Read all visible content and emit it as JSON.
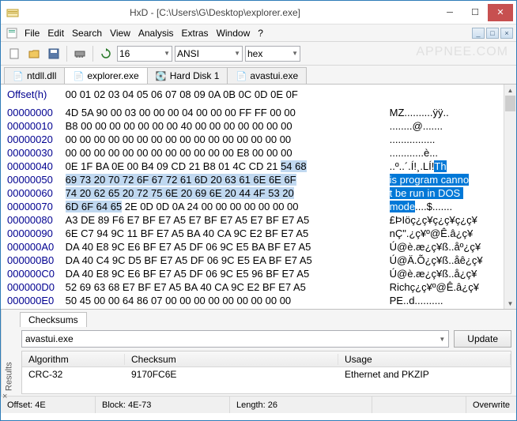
{
  "window": {
    "title": "HxD - [C:\\Users\\G\\Desktop\\explorer.exe]",
    "watermark": "APPNEE.COM"
  },
  "menus": [
    "File",
    "Edit",
    "Search",
    "View",
    "Analysis",
    "Extras",
    "Window",
    "?"
  ],
  "toolbar": {
    "bytes_per_row": "16",
    "charset": "ANSI",
    "base": "hex"
  },
  "tabs": [
    {
      "icon": "file-icon",
      "label": "ntdll.dll",
      "active": false
    },
    {
      "icon": "file-icon",
      "label": "explorer.exe",
      "active": true
    },
    {
      "icon": "disk-icon",
      "label": "Hard Disk 1",
      "active": false
    },
    {
      "icon": "file-icon",
      "label": "avastui.exe",
      "active": false
    }
  ],
  "hex": {
    "header_offset": "Offset(h)",
    "header_cols": "00 01 02 03 04 05 06 07 08 09 0A 0B 0C 0D 0E 0F",
    "rows": [
      {
        "off": "00000000",
        "b": "4D 5A 90 00 03 00 00 00 04 00 00 00 FF FF 00 00",
        "a": "MZ..........ÿÿ.."
      },
      {
        "off": "00000010",
        "b": "B8 00 00 00 00 00 00 00 40 00 00 00 00 00 00 00",
        "a": "........@......."
      },
      {
        "off": "00000020",
        "b": "00 00 00 00 00 00 00 00 00 00 00 00 00 00 00 00",
        "a": "................"
      },
      {
        "off": "00000030",
        "b": "00 00 00 00 00 00 00 00 00 00 00 00 E8 00 00 00",
        "a": "............è..."
      },
      {
        "off": "00000040",
        "b_pre": "0E 1F BA 0E 00 B4 09 CD 21 B8 01 4C CD 21 ",
        "b_sel": "54 68",
        "a_pre": "..º..´.Í!¸.LÍ!",
        "a_sel": "Th"
      },
      {
        "off": "00000050",
        "b_sel": "69 73 20 70 72 6F 67 72 61 6D 20 63 61 6E 6E 6F",
        "a_sel": "is program canno"
      },
      {
        "off": "00000060",
        "b_sel": "74 20 62 65 20 72 75 6E 20 69 6E 20 44 4F 53 20",
        "a_sel": "t be run in DOS "
      },
      {
        "off": "00000070",
        "b_sel": "6D 6F 64 65",
        "b_post": " 2E 0D 0D 0A 24 00 00 00 00 00 00 00",
        "a_sel": "mode",
        "a_post": "....$......."
      },
      {
        "off": "00000080",
        "b": "A3 DE 89 F6 E7 BF E7 A5 E7 BF E7 A5 E7 BF E7 A5",
        "a": "£ÞIöç¿ç¥ç¿ç¥ç¿ç¥"
      },
      {
        "off": "00000090",
        "b": "6E C7 94 9C 11 BF E7 A5 BA 40 CA 9C E2 BF E7 A5",
        "a": "nÇ\".¿ç¥º@Ê.â¿ç¥"
      },
      {
        "off": "000000A0",
        "b": "DA 40 E8 9C E6 BF E7 A5 DF 06 9C E5 BA BF E7 A5",
        "a": "Ú@è.æ¿ç¥ß..åº¿ç¥"
      },
      {
        "off": "000000B0",
        "b": "DA 40 C4 9C D5 BF E7 A5 DF 06 9C E5 EA BF E7 A5",
        "a": "Ú@Ä.Õ¿ç¥ß..åê¿ç¥"
      },
      {
        "off": "000000C0",
        "b": "DA 40 E8 9C E6 BF E7 A5 DF 06 9C E5 96 BF E7 A5",
        "a": "Ú@è.æ¿ç¥ß..å¿ç¥"
      },
      {
        "off": "000000D0",
        "b": "52 69 63 68 E7 BF E7 A5 BA 40 CA 9C E2 BF E7 A5",
        "a": "Richç¿ç¥º@Ê.â¿ç¥"
      },
      {
        "off": "000000E0",
        "b": "50 45 00 00 64 86 07 00 00 00 00 00 00 00 00 00",
        "a": "PE..d.........."
      }
    ]
  },
  "results": {
    "side_label": "Results",
    "tab": "Checksums",
    "file_selected": "avastui.exe",
    "update_btn": "Update",
    "columns": [
      "Algorithm",
      "Checksum",
      "Usage"
    ],
    "rows": [
      {
        "algo": "CRC-32",
        "sum": "9170FC6E",
        "usage": "Ethernet and PKZIP"
      }
    ]
  },
  "status": {
    "offset": "Offset: 4E",
    "block": "Block: 4E-73",
    "length": "Length: 26",
    "mode": "Overwrite"
  }
}
